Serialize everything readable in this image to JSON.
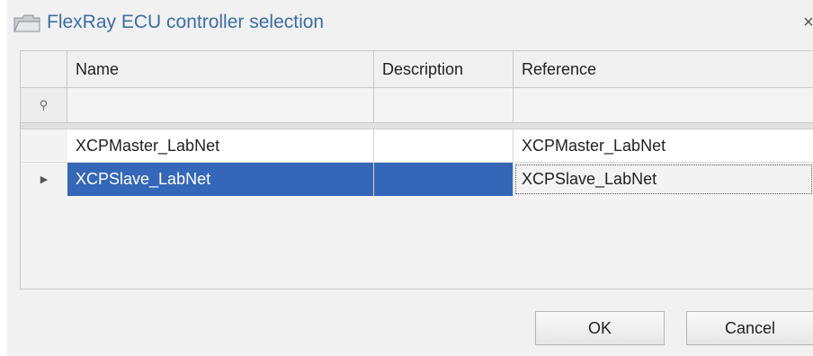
{
  "dialog": {
    "title": "FlexRay ECU controller selection",
    "close_glyph": "×",
    "title_icon": "folder-icon"
  },
  "grid": {
    "columns": [
      "Name",
      "Description",
      "Reference"
    ],
    "filter_icon": "⚲",
    "row_indicator": "▶",
    "rows": [
      {
        "name": "XCPMaster_LabNet",
        "description": "",
        "reference": "XCPMaster_LabNet",
        "selected": false
      },
      {
        "name": "XCPSlave_LabNet",
        "description": "",
        "reference": "XCPSlave_LabNet",
        "selected": true
      }
    ]
  },
  "buttons": {
    "ok_label": "OK",
    "cancel_label": "Cancel"
  },
  "colors": {
    "accent": "#3a6ea5",
    "selection": "#3467b8"
  }
}
